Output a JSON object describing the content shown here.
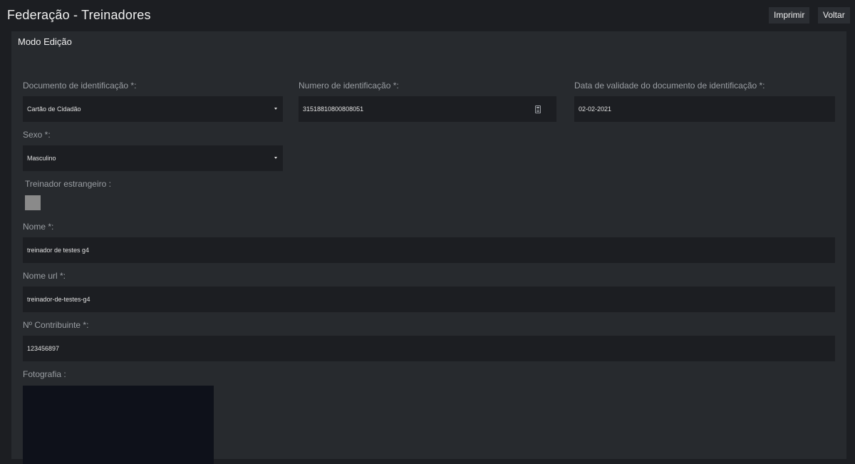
{
  "header": {
    "title": "Federação - Treinadores",
    "print_label": "Imprimir",
    "back_label": "Voltar"
  },
  "panel": {
    "title": "Modo Edição"
  },
  "form": {
    "doc_type": {
      "label": "Documento de identificação *:",
      "value": "Cartão de Cidadão"
    },
    "doc_number": {
      "label": "Numero de identificação *:",
      "value": "31518810800808051"
    },
    "doc_validity": {
      "label": "Data de validade do documento de identificação *:",
      "value": "02-02-2021"
    },
    "sex": {
      "label": "Sexo *:",
      "value": "Masculino"
    },
    "foreign": {
      "label": "Treinador estrangeiro :",
      "checked": false
    },
    "name": {
      "label": "Nome *:",
      "value": "treinador de testes g4"
    },
    "name_url": {
      "label": "Nome url *:",
      "value": "treinador-de-testes-g4"
    },
    "taxpayer": {
      "label": "Nº Contribuinte *:",
      "value": "123456897"
    },
    "photo": {
      "label": "Fotografia :"
    }
  },
  "colors": {
    "background": "#1c1e22",
    "panel": "#272a2e",
    "field": "#1c1e22",
    "label": "#9a9ea3",
    "photo_placeholder": "#0e111a"
  }
}
